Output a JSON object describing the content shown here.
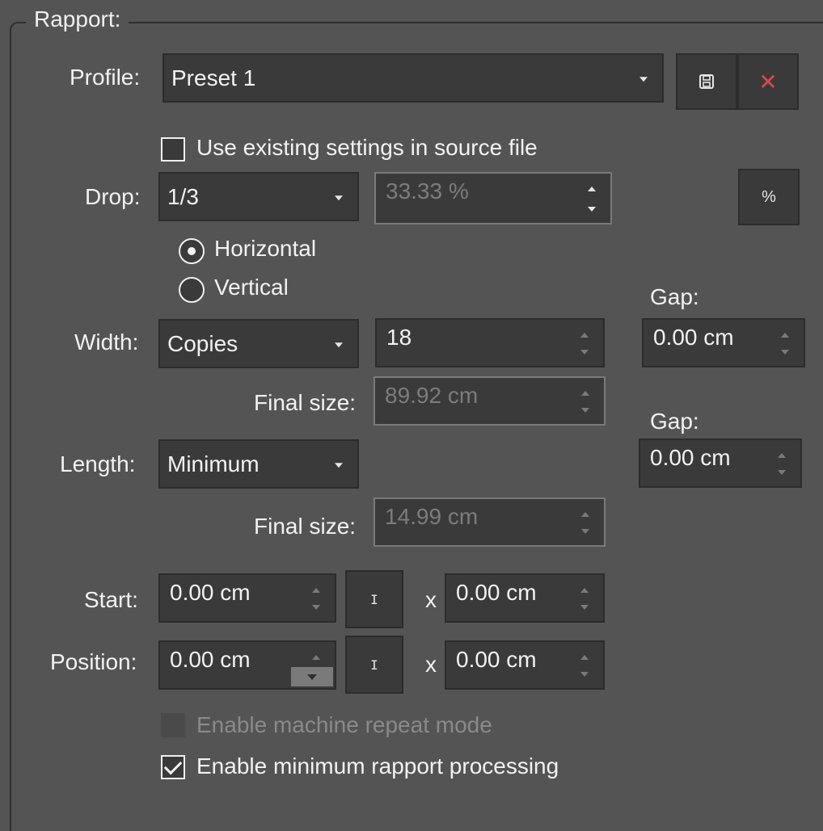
{
  "group": {
    "title": "Rapport:"
  },
  "profile": {
    "label": "Profile:",
    "selected": "Preset 1",
    "save_icon": "save-icon",
    "delete_icon": "close-icon",
    "delete_color": "#d94a4a"
  },
  "use_existing": {
    "label": "Use existing settings in source file",
    "checked": false
  },
  "drop": {
    "label": "Drop:",
    "selected": "1/3",
    "percent_value": "33.33 %",
    "percent_icon": "%"
  },
  "orientation": {
    "horizontal_label": "Horizontal",
    "vertical_label": "Vertical",
    "selected": "Horizontal"
  },
  "width": {
    "label": "Width:",
    "mode": "Copies",
    "count": "18",
    "gap_label": "Gap:",
    "gap_value": "0.00 cm",
    "final_label": "Final size:",
    "final_value": "89.92 cm"
  },
  "length": {
    "label": "Length:",
    "mode": "Minimum",
    "gap_label": "Gap:",
    "gap_value": "0.00 cm",
    "final_label": "Final size:",
    "final_value": "14.99 cm"
  },
  "start": {
    "label": "Start:",
    "x_value": "0.00 cm",
    "separator": "x",
    "y_value": "0.00 cm",
    "link_icon": "I"
  },
  "position": {
    "label": "Position:",
    "x_value": "0.00 cm",
    "separator": "x",
    "y_value": "0.00 cm",
    "link_icon": "I"
  },
  "machine_repeat": {
    "label": "Enable machine repeat mode",
    "checked": false,
    "enabled": false
  },
  "min_rapport": {
    "label": "Enable minimum rapport processing",
    "checked": true
  }
}
